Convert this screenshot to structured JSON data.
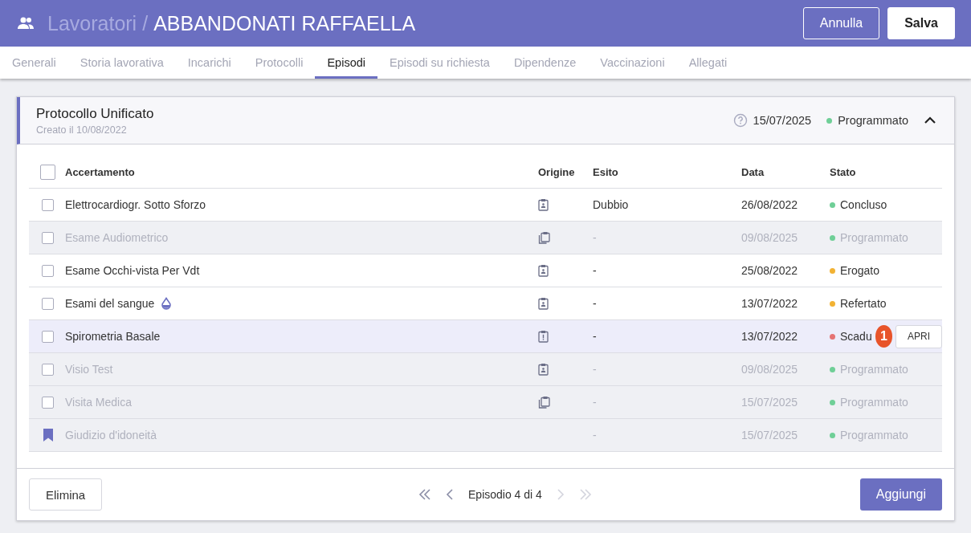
{
  "header": {
    "section": "Lavoratori",
    "separator": "/",
    "worker": "ABBANDONATI RAFFAELLA",
    "buttons": [
      {
        "label": "Annulla",
        "kind": "outline"
      },
      {
        "label": "Salva",
        "kind": "solid"
      }
    ]
  },
  "tabs": [
    {
      "label": "Generali",
      "selected": false
    },
    {
      "label": "Storia lavorativa",
      "selected": false
    },
    {
      "label": "Incarichi",
      "selected": false
    },
    {
      "label": "Protocolli",
      "selected": false
    },
    {
      "label": "Episodi",
      "selected": true
    },
    {
      "label": "Episodi su richiesta",
      "selected": false
    },
    {
      "label": "Dipendenze",
      "selected": false
    },
    {
      "label": "Vaccinazioni",
      "selected": false
    },
    {
      "label": "Allegati",
      "selected": false
    }
  ],
  "protocol": {
    "title": "Protocollo Unificato",
    "created": "Creato il 10/08/2022",
    "date": "15/07/2025",
    "status": "Programmato",
    "color": "#6fcf97",
    "expanded": true
  },
  "table": {
    "select_all_checked": false,
    "columns": [
      "Accertamento",
      "Origine",
      "Esito",
      "Data",
      "Stato"
    ],
    "rows": [
      {
        "kind": "checkbox",
        "checked": false,
        "name": "Elettrocardiogr. Sotto Sforzo",
        "blood": false,
        "origin": {
          "kind": "person"
        },
        "esito": "Dubbio",
        "date": "26/08/2022",
        "status": "Concluso",
        "color": "#6fcf97",
        "disabled": false,
        "highlighted": false
      },
      {
        "kind": "checkbox",
        "checked": false,
        "name": "Esame Audiometrico",
        "blood": false,
        "origin": {
          "kind": "copy"
        },
        "esito": "-",
        "date": "09/08/2025",
        "status": "Programmato",
        "color": "#6fcf97",
        "disabled": true,
        "highlighted": false
      },
      {
        "kind": "checkbox",
        "checked": false,
        "name": "Esame Occhi-vista Per Vdt",
        "blood": false,
        "origin": {
          "kind": "person"
        },
        "esito": "-",
        "date": "25/08/2022",
        "status": "Erogato",
        "color": "#f2b233",
        "disabled": false,
        "highlighted": false
      },
      {
        "kind": "checkbox",
        "checked": false,
        "name": "Esami del sangue",
        "blood": true,
        "origin": {
          "kind": "person"
        },
        "esito": "-",
        "date": "13/07/2022",
        "status": "Refertato",
        "color": "#f2b233",
        "disabled": false,
        "highlighted": false
      },
      {
        "kind": "checkbox",
        "checked": false,
        "name": "Spirometria Basale",
        "blood": false,
        "origin": {
          "kind": "alert"
        },
        "esito": "-",
        "date": "13/07/2022",
        "status": "Scadu",
        "color": "#e57373",
        "disabled": false,
        "highlighted": true,
        "badge": "1",
        "action": "APRI"
      },
      {
        "kind": "checkbox",
        "checked": false,
        "name": "Visio Test",
        "blood": false,
        "origin": {
          "kind": "person"
        },
        "esito": "-",
        "date": "09/08/2025",
        "status": "Programmato",
        "color": "#6fcf97",
        "disabled": true,
        "highlighted": false
      },
      {
        "kind": "checkbox",
        "checked": false,
        "name": "Visita Medica",
        "blood": false,
        "origin": {
          "kind": "copy"
        },
        "esito": "-",
        "date": "15/07/2025",
        "status": "Programmato",
        "color": "#6fcf97",
        "disabled": true,
        "highlighted": false
      },
      {
        "kind": "bookmark",
        "name": "Giudizio d'idoneità",
        "blood": false,
        "esito": "-",
        "date": "15/07/2025",
        "status": "Programmato",
        "color": "#6fcf97",
        "disabled": true,
        "highlighted": false
      }
    ]
  },
  "footer": {
    "delete": "Elimina",
    "pager": {
      "label": "Episodio 4 di 4",
      "first_disabled": false,
      "prev_disabled": false,
      "next_disabled": true,
      "last_disabled": true
    },
    "add": "Aggiungi"
  }
}
